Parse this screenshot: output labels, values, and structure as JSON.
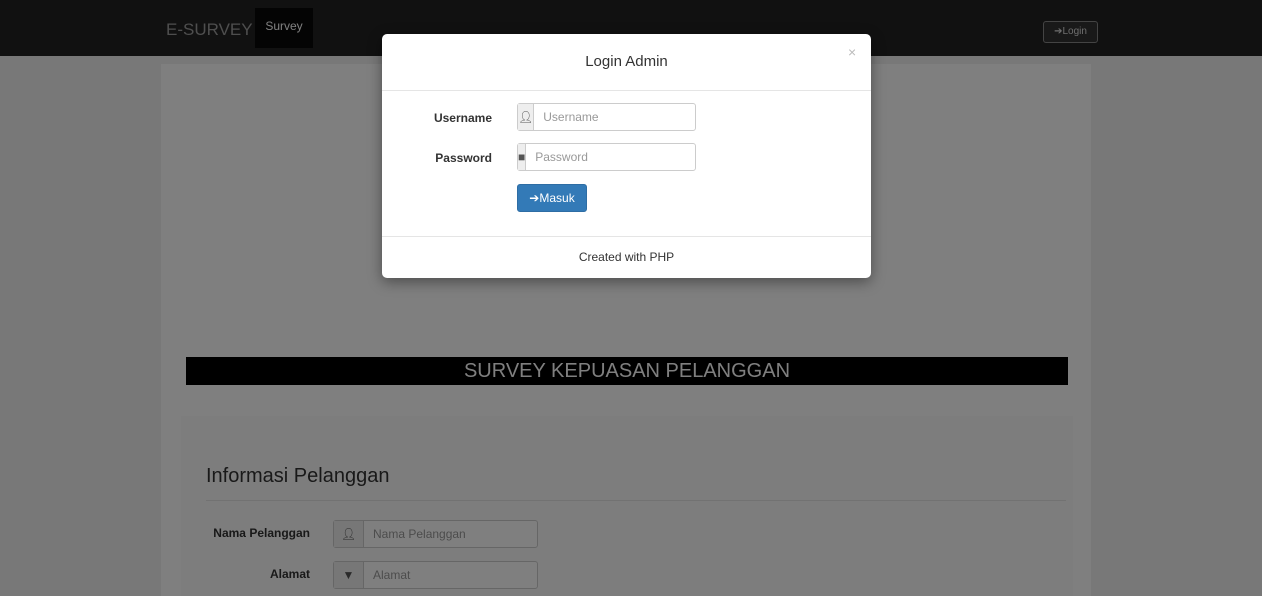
{
  "navbar": {
    "brand": "E-SURVEY",
    "active_item": "Survey",
    "login_label": "Login"
  },
  "page": {
    "banner": "SURVEY KEPUASAN PELANGGAN",
    "panel_title": "Informasi Pelanggan",
    "fields": [
      {
        "label": "Nama Pelanggan",
        "placeholder": "Nama Pelanggan",
        "icon": "user-icon"
      },
      {
        "label": "Alamat",
        "placeholder": "Alamat",
        "icon": "bookmark-icon"
      }
    ]
  },
  "modal": {
    "title": "Login Admin",
    "close": "×",
    "username_label": "Username",
    "username_placeholder": "Username",
    "password_label": "Password",
    "password_placeholder": "Password",
    "submit_label": "Masuk",
    "footer": "Created with PHP"
  },
  "colors": {
    "navbar": "#222222",
    "primary_button": "#337ab7",
    "banner": "#000000"
  }
}
